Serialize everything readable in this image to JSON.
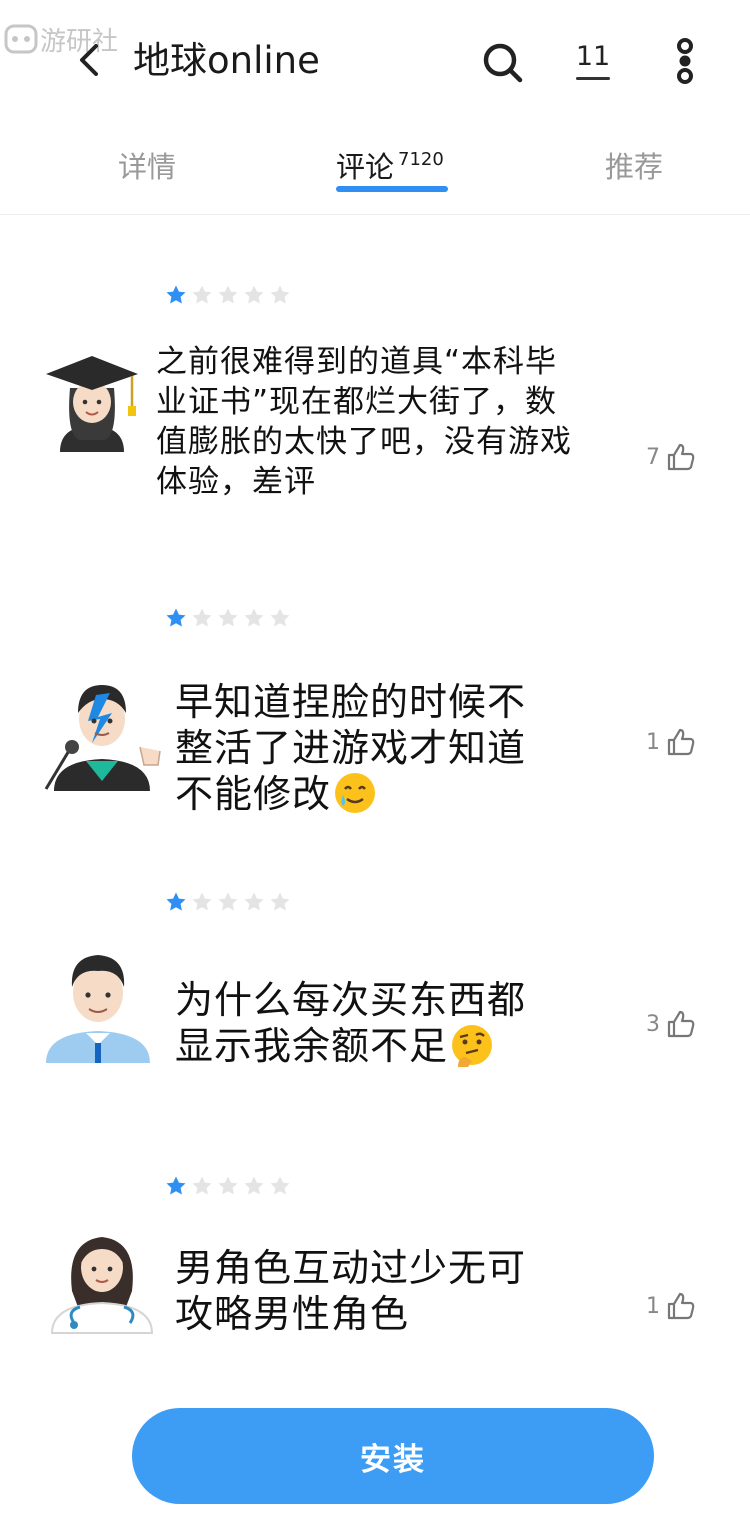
{
  "header": {
    "watermark": "游研社",
    "title": "地球online",
    "count": "11"
  },
  "tabs": [
    {
      "label": "详情"
    },
    {
      "label": "评论",
      "count": "7120"
    },
    {
      "label": "推荐"
    }
  ],
  "reviews": [
    {
      "rating": 1,
      "avatar": "woman-graduate-avatar",
      "text_lines": [
        "之前很难得到的道具“本科毕",
        "业证书”现在都烂大街了，数",
        "值膨胀的太快了吧，没有游戏",
        "体验，差评"
      ],
      "likes": "7"
    },
    {
      "rating": 1,
      "avatar": "man-singer-avatar",
      "text_lines": [
        "早知道捏脸的时候不",
        "整活了进游戏才知道",
        "不能修改"
      ],
      "emoji": "smiling-face-with-tear",
      "likes": "1"
    },
    {
      "rating": 1,
      "avatar": "man-office-worker-avatar",
      "text_lines": [
        "为什么每次买东西都",
        "显示我余额不足"
      ],
      "emoji": "thinking-face",
      "likes": "3"
    },
    {
      "rating": 1,
      "avatar": "woman-health-worker-avatar",
      "text_lines": [
        "男角色互动过少无可",
        "攻略男性角色"
      ],
      "likes": "1"
    }
  ],
  "install_button": {
    "label": "安装"
  },
  "colors": {
    "accent": "#2f8ff3",
    "star_filled": "#2f8ff3",
    "star_empty": "#e4e4e4",
    "button": "#3d9df5"
  }
}
